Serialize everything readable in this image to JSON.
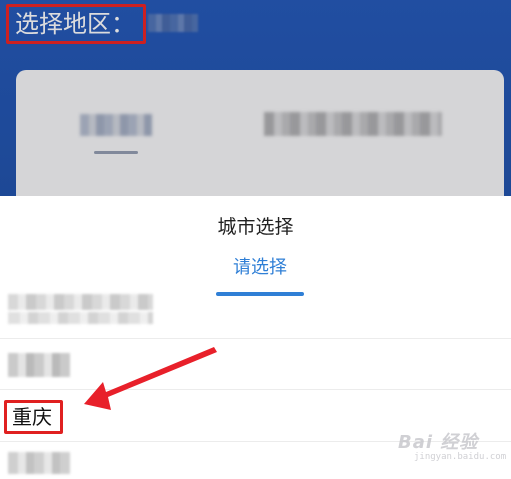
{
  "header": {
    "region_label": "选择地区："
  },
  "sheet": {
    "title": "城市选择",
    "tab_label": "请选择",
    "selected_city": "重庆"
  },
  "colors": {
    "accent": "#2f7fd6",
    "highlight_box": "#e02020",
    "header_bg": "#1d4fa6"
  },
  "watermark": {
    "text": "Bai 经验",
    "subtext": "jingyan.baidu.com"
  }
}
